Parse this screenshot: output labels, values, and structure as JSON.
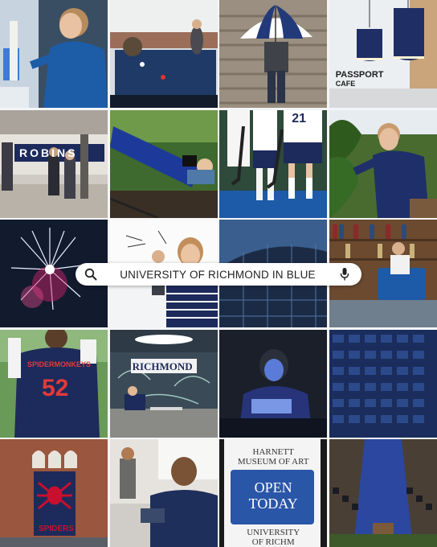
{
  "search": {
    "query": "UNIVERSITY OF RICHMOND IN BLUE"
  },
  "signs": {
    "passport_line1": "PASSPORT",
    "passport_line2": "CAFE",
    "robins_banner": "ROBINS",
    "jersey_21": "21",
    "jersey_team": "SPIDERMONKEYS",
    "jersey_52": "52",
    "richmond_wall": "RICHMOND",
    "spiders_banner": "SPIDERS",
    "museum_line1": "HARNETT",
    "museum_line2": "MUSEUM OF ART",
    "open_line1": "OPEN",
    "open_line2": "TODAY",
    "university_line1": "UNIVERSITY",
    "university_line2": "OF RICHM"
  },
  "colors": {
    "background": "#f4f5f7",
    "brand_navy": "#1d2a5c",
    "brand_red": "#c8102e",
    "museum_blue": "#2a56a8"
  },
  "icons": {
    "search": "magnifier-icon",
    "voice": "microphone-icon"
  }
}
